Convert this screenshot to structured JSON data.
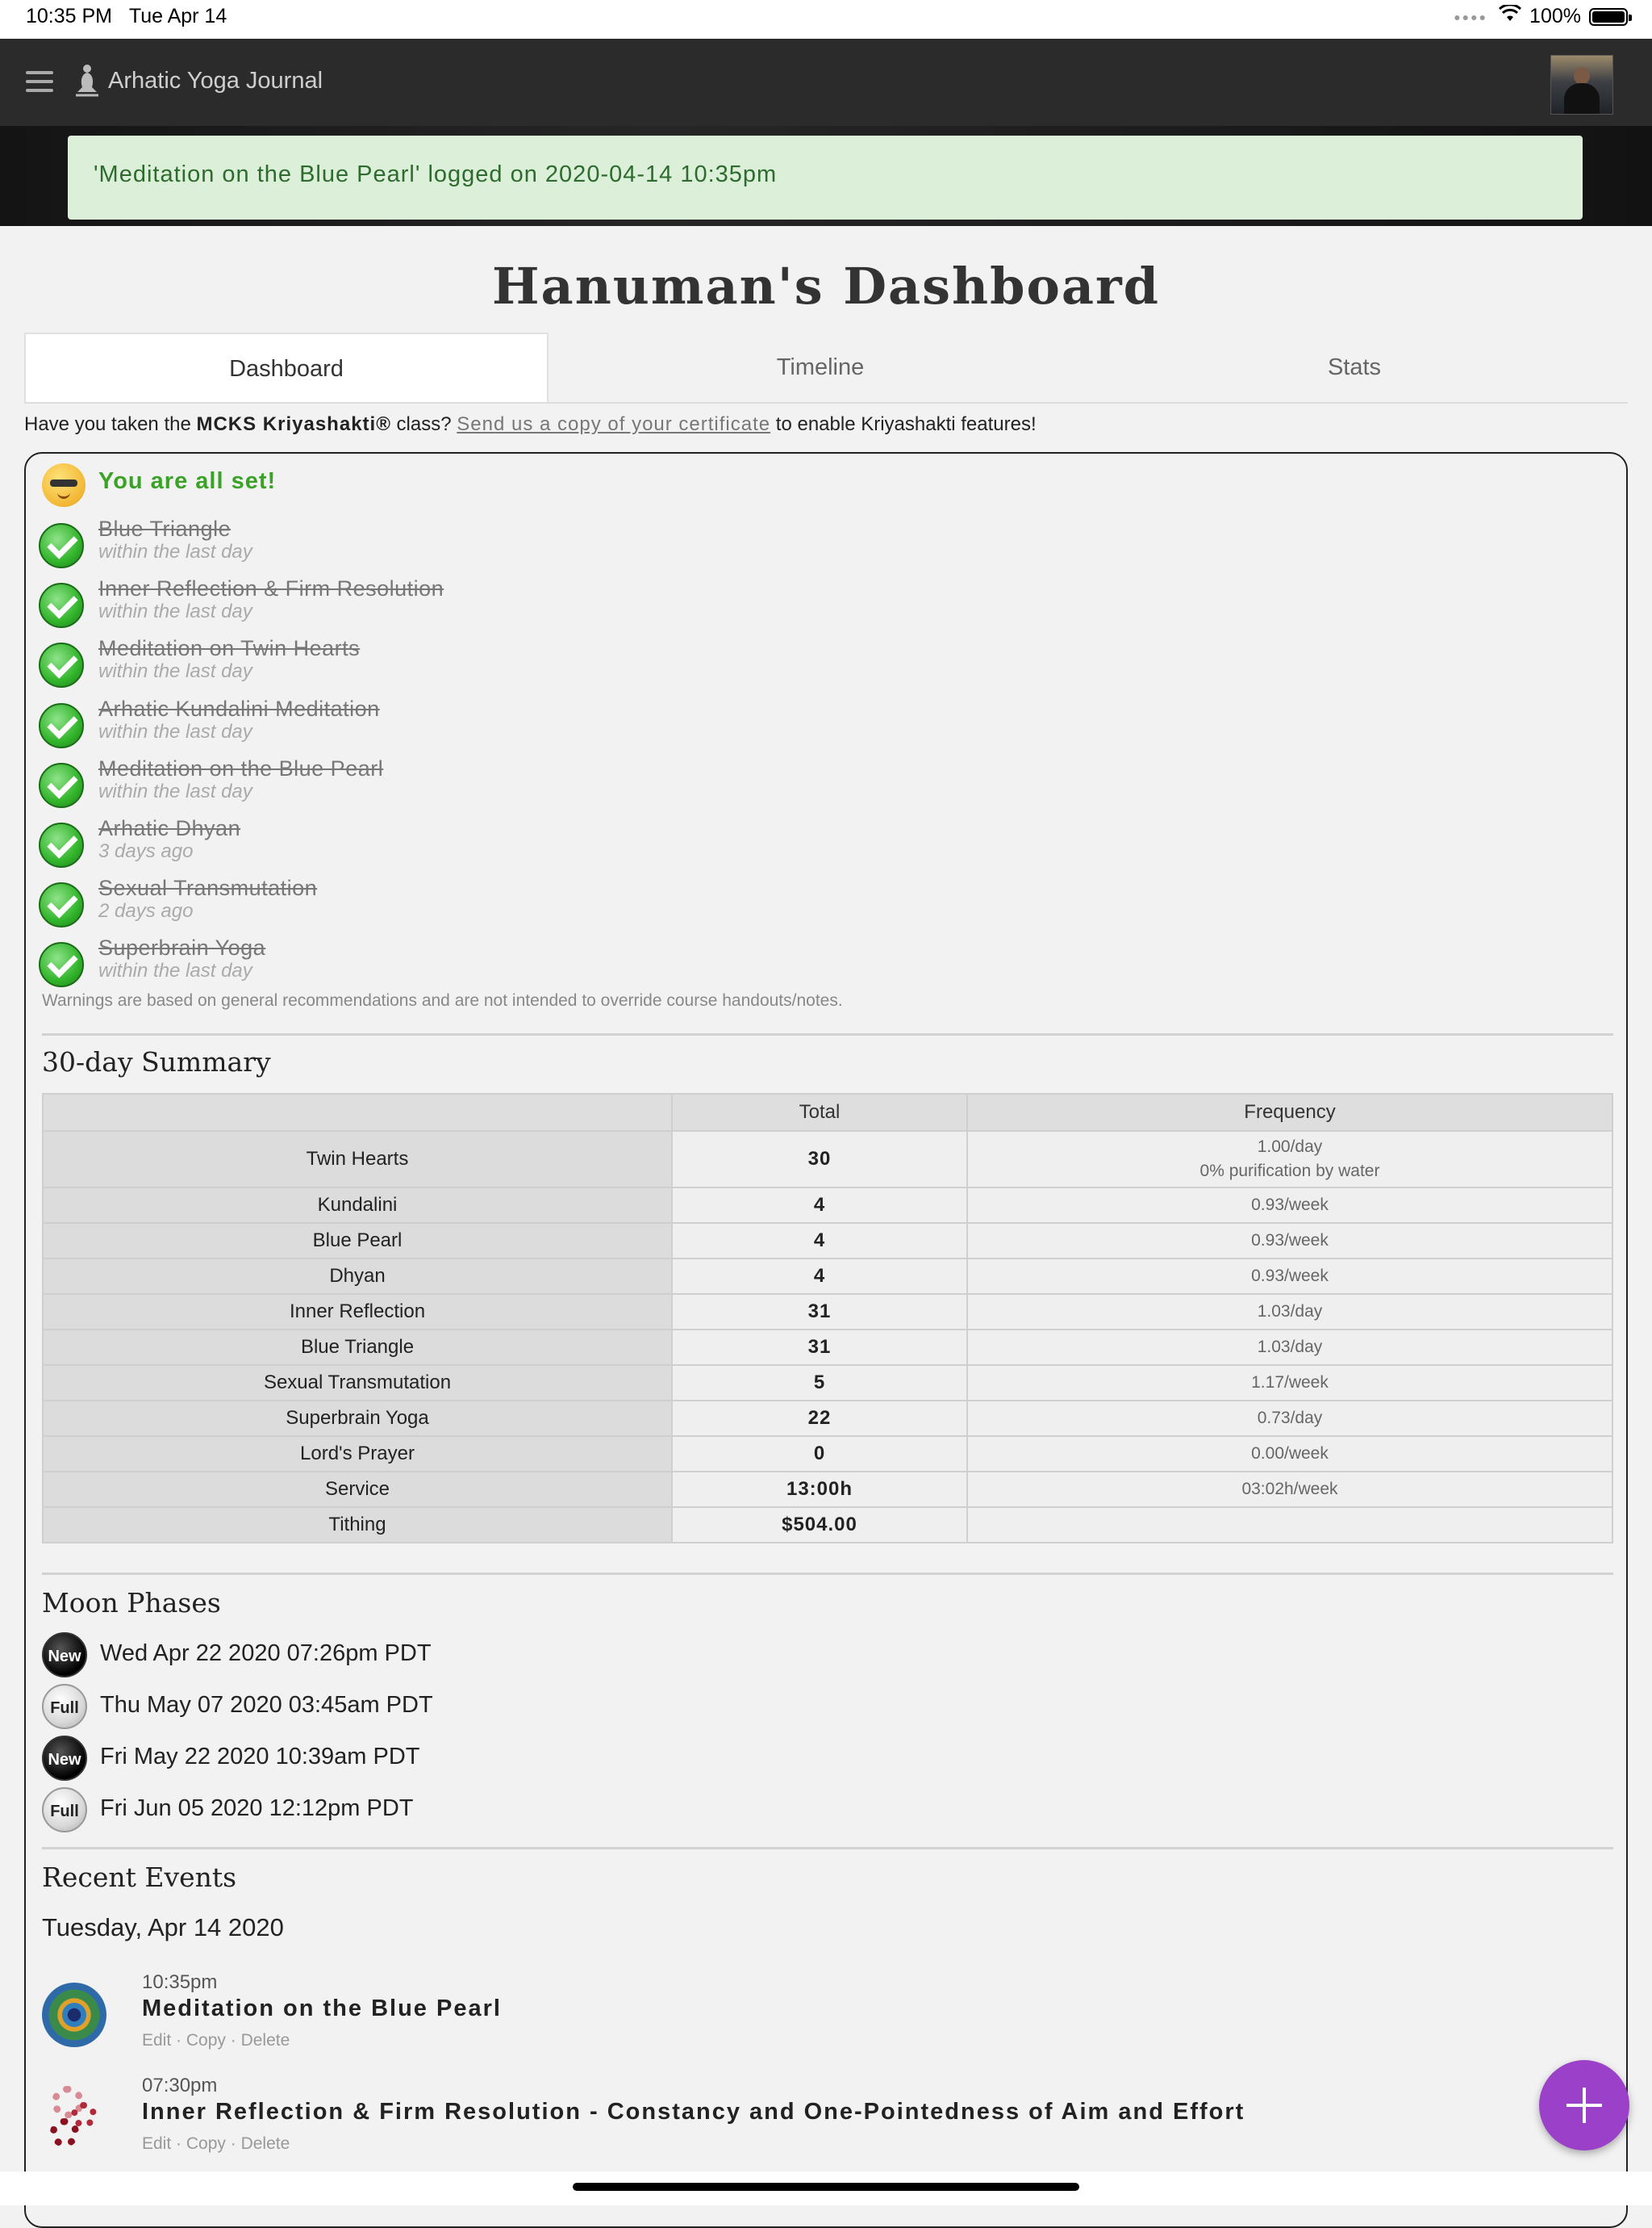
{
  "status_bar": {
    "time": "10:35 PM",
    "date": "Tue Apr 14",
    "battery": "100%",
    "battery_level": 1.0
  },
  "nav": {
    "title": "Arhatic Yoga Journal"
  },
  "alert": {
    "message": "'Meditation on the Blue Pearl' logged on 2020-04-14 10:35pm"
  },
  "page": {
    "title": "Hanuman's Dashboard"
  },
  "tabs": [
    {
      "label": "Dashboard",
      "active": true
    },
    {
      "label": "Timeline",
      "active": false
    },
    {
      "label": "Stats",
      "active": false
    }
  ],
  "notice": {
    "prefix": "Have you taken the ",
    "course": "MCKS Kriyashakti®",
    "middle": " class? ",
    "link": "Send us a copy of your certificate",
    "suffix": " to enable Kriyashakti features!"
  },
  "checklist": {
    "header": "You are all set!",
    "items": [
      {
        "name": "Blue Triangle",
        "when": "within the last day"
      },
      {
        "name": "Inner Reflection & Firm Resolution",
        "when": "within the last day"
      },
      {
        "name": "Meditation on Twin Hearts",
        "when": "within the last day"
      },
      {
        "name": "Arhatic Kundalini Meditation",
        "when": "within the last day"
      },
      {
        "name": "Meditation on the Blue Pearl",
        "when": "within the last day"
      },
      {
        "name": "Arhatic Dhyan",
        "when": "3 days ago"
      },
      {
        "name": "Sexual Transmutation",
        "when": "2 days ago"
      },
      {
        "name": "Superbrain Yoga",
        "when": "within the last day"
      }
    ],
    "footnote": "Warnings are based on general recommendations and are not intended to override course handouts/notes."
  },
  "summary": {
    "title": "30-day Summary",
    "columns": [
      "",
      "Total",
      "Frequency"
    ],
    "rows": [
      {
        "name": "Twin Hearts",
        "total": "30",
        "freq": "1.00/day",
        "freq2": "0% purification by water"
      },
      {
        "name": "Kundalini",
        "total": "4",
        "freq": "0.93/week"
      },
      {
        "name": "Blue Pearl",
        "total": "4",
        "freq": "0.93/week"
      },
      {
        "name": "Dhyan",
        "total": "4",
        "freq": "0.93/week"
      },
      {
        "name": "Inner Reflection",
        "total": "31",
        "freq": "1.03/day"
      },
      {
        "name": "Blue Triangle",
        "total": "31",
        "freq": "1.03/day"
      },
      {
        "name": "Sexual Transmutation",
        "total": "5",
        "freq": "1.17/week"
      },
      {
        "name": "Superbrain Yoga",
        "total": "22",
        "freq": "0.73/day"
      },
      {
        "name": "Lord's Prayer",
        "total": "0",
        "freq": "0.00/week"
      },
      {
        "name": "Service",
        "total": "13:00h",
        "freq": "03:02h/week"
      },
      {
        "name": "Tithing",
        "total": "$504.00",
        "freq": ""
      }
    ]
  },
  "moon": {
    "title": "Moon Phases",
    "phases": [
      {
        "type": "New",
        "date": "Wed Apr 22 2020 07:26pm PDT"
      },
      {
        "type": "Full",
        "date": "Thu May 07 2020 03:45am PDT"
      },
      {
        "type": "New",
        "date": "Fri May 22 2020 10:39am PDT"
      },
      {
        "type": "Full",
        "date": "Fri Jun 05 2020 12:12pm PDT"
      }
    ]
  },
  "events": {
    "title": "Recent Events",
    "day": "Tuesday, Apr 14 2020",
    "items": [
      {
        "time": "10:35pm",
        "title": "Meditation on the Blue Pearl",
        "icon": "blue-pearl-icon"
      },
      {
        "time": "07:30pm",
        "title": "Inner Reflection & Firm Resolution - Constancy and One-Pointedness of Aim and Effort",
        "icon": "gears-icon"
      }
    ],
    "actions": {
      "edit": "Edit",
      "copy": "Copy",
      "delete": "Delete",
      "sep": " · "
    }
  }
}
